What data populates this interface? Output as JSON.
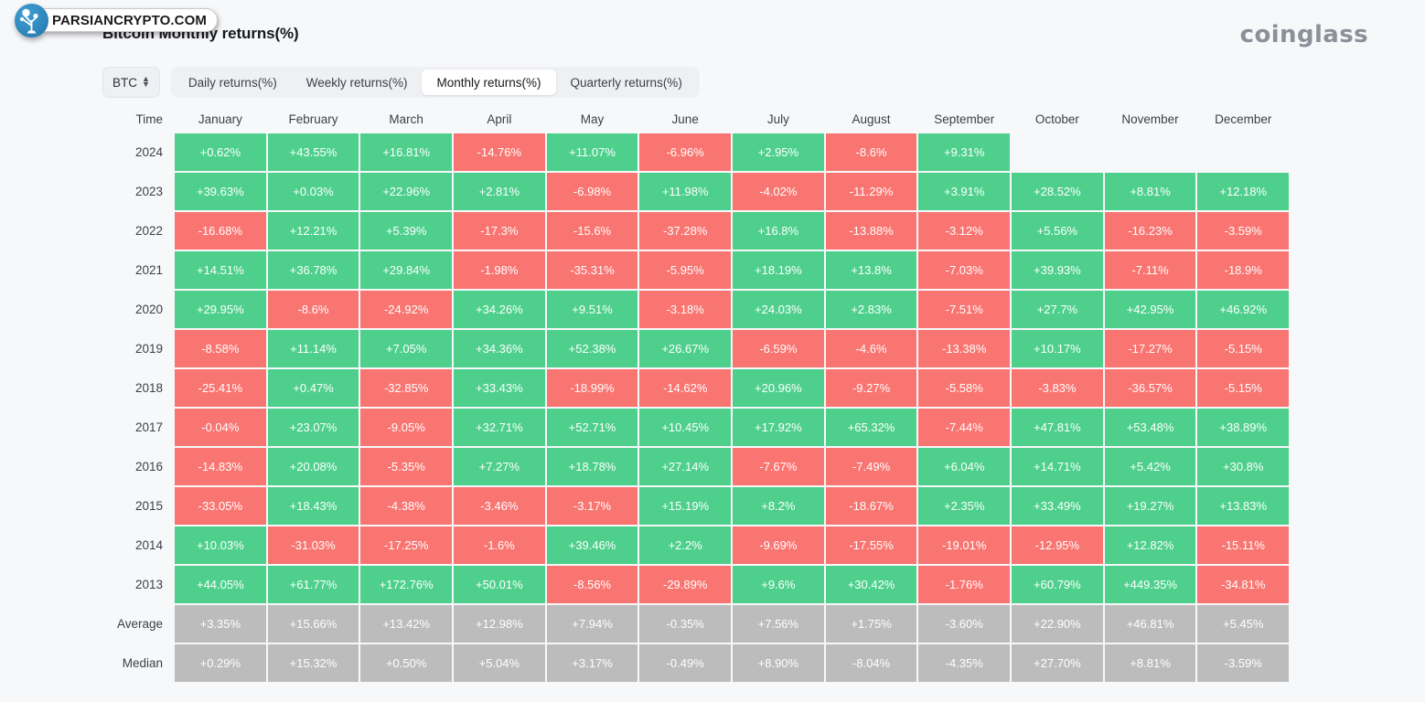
{
  "header": {
    "title": "Bitcoin Monthly returns(%)",
    "brand": "coinglass"
  },
  "watermark": {
    "text": "PARSIANCRYPTO.COM",
    "icon": "tree-network-icon"
  },
  "controls": {
    "coin_selector": {
      "value": "BTC",
      "icon": "chevron-up-down-icon"
    },
    "tabs": [
      {
        "label": "Daily returns(%)",
        "active": false
      },
      {
        "label": "Weekly returns(%)",
        "active": false
      },
      {
        "label": "Monthly returns(%)",
        "active": true
      },
      {
        "label": "Quarterly returns(%)",
        "active": false
      }
    ]
  },
  "colors": {
    "positive": "#4ed08c",
    "negative": "#f97571",
    "stat": "#bcbcbc",
    "background": "#f7f8fa",
    "brand_gray": "#8b9199"
  },
  "table": {
    "columns": [
      "Time",
      "January",
      "February",
      "March",
      "April",
      "May",
      "June",
      "July",
      "August",
      "September",
      "October",
      "November",
      "December"
    ],
    "rows": [
      {
        "label": "2024",
        "kind": "year",
        "values": [
          "+0.62%",
          "+43.55%",
          "+16.81%",
          "-14.76%",
          "+11.07%",
          "-6.96%",
          "+2.95%",
          "-8.6%",
          "+9.31%",
          "",
          "",
          ""
        ]
      },
      {
        "label": "2023",
        "kind": "year",
        "values": [
          "+39.63%",
          "+0.03%",
          "+22.96%",
          "+2.81%",
          "-6.98%",
          "+11.98%",
          "-4.02%",
          "-11.29%",
          "+3.91%",
          "+28.52%",
          "+8.81%",
          "+12.18%"
        ]
      },
      {
        "label": "2022",
        "kind": "year",
        "values": [
          "-16.68%",
          "+12.21%",
          "+5.39%",
          "-17.3%",
          "-15.6%",
          "-37.28%",
          "+16.8%",
          "-13.88%",
          "-3.12%",
          "+5.56%",
          "-16.23%",
          "-3.59%"
        ]
      },
      {
        "label": "2021",
        "kind": "year",
        "values": [
          "+14.51%",
          "+36.78%",
          "+29.84%",
          "-1.98%",
          "-35.31%",
          "-5.95%",
          "+18.19%",
          "+13.8%",
          "-7.03%",
          "+39.93%",
          "-7.11%",
          "-18.9%"
        ]
      },
      {
        "label": "2020",
        "kind": "year",
        "values": [
          "+29.95%",
          "-8.6%",
          "-24.92%",
          "+34.26%",
          "+9.51%",
          "-3.18%",
          "+24.03%",
          "+2.83%",
          "-7.51%",
          "+27.7%",
          "+42.95%",
          "+46.92%"
        ]
      },
      {
        "label": "2019",
        "kind": "year",
        "values": [
          "-8.58%",
          "+11.14%",
          "+7.05%",
          "+34.36%",
          "+52.38%",
          "+26.67%",
          "-6.59%",
          "-4.6%",
          "-13.38%",
          "+10.17%",
          "-17.27%",
          "-5.15%"
        ]
      },
      {
        "label": "2018",
        "kind": "year",
        "values": [
          "-25.41%",
          "+0.47%",
          "-32.85%",
          "+33.43%",
          "-18.99%",
          "-14.62%",
          "+20.96%",
          "-9.27%",
          "-5.58%",
          "-3.83%",
          "-36.57%",
          "-5.15%"
        ]
      },
      {
        "label": "2017",
        "kind": "year",
        "values": [
          "-0.04%",
          "+23.07%",
          "-9.05%",
          "+32.71%",
          "+52.71%",
          "+10.45%",
          "+17.92%",
          "+65.32%",
          "-7.44%",
          "+47.81%",
          "+53.48%",
          "+38.89%"
        ]
      },
      {
        "label": "2016",
        "kind": "year",
        "values": [
          "-14.83%",
          "+20.08%",
          "-5.35%",
          "+7.27%",
          "+18.78%",
          "+27.14%",
          "-7.67%",
          "-7.49%",
          "+6.04%",
          "+14.71%",
          "+5.42%",
          "+30.8%"
        ]
      },
      {
        "label": "2015",
        "kind": "year",
        "values": [
          "-33.05%",
          "+18.43%",
          "-4.38%",
          "-3.46%",
          "-3.17%",
          "+15.19%",
          "+8.2%",
          "-18.67%",
          "+2.35%",
          "+33.49%",
          "+19.27%",
          "+13.83%"
        ]
      },
      {
        "label": "2014",
        "kind": "year",
        "values": [
          "+10.03%",
          "-31.03%",
          "-17.25%",
          "-1.6%",
          "+39.46%",
          "+2.2%",
          "-9.69%",
          "-17.55%",
          "-19.01%",
          "-12.95%",
          "+12.82%",
          "-15.11%"
        ]
      },
      {
        "label": "2013",
        "kind": "year",
        "values": [
          "+44.05%",
          "+61.77%",
          "+172.76%",
          "+50.01%",
          "-8.56%",
          "-29.89%",
          "+9.6%",
          "+30.42%",
          "-1.76%",
          "+60.79%",
          "+449.35%",
          "-34.81%"
        ]
      },
      {
        "label": "Average",
        "kind": "stat",
        "values": [
          "+3.35%",
          "+15.66%",
          "+13.42%",
          "+12.98%",
          "+7.94%",
          "-0.35%",
          "+7.56%",
          "+1.75%",
          "-3.60%",
          "+22.90%",
          "+46.81%",
          "+5.45%"
        ]
      },
      {
        "label": "Median",
        "kind": "stat",
        "values": [
          "+0.29%",
          "+15.32%",
          "+0.50%",
          "+5.04%",
          "+3.17%",
          "-0.49%",
          "+8.90%",
          "-8.04%",
          "-4.35%",
          "+27.70%",
          "+8.81%",
          "-3.59%"
        ]
      }
    ]
  }
}
